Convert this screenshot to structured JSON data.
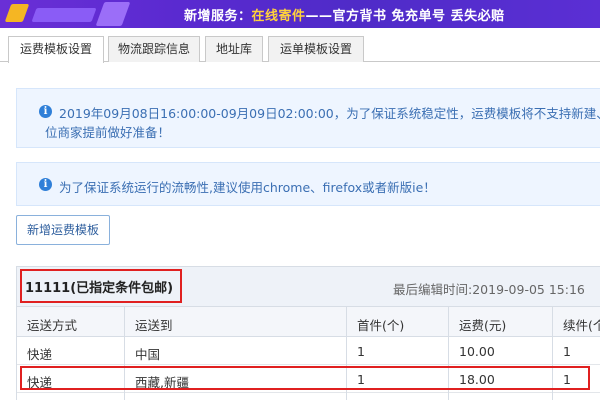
{
  "banner": {
    "prefix": "新增服务：",
    "highlight": "在线寄件",
    "suffix": "——官方背书 免充单号 丢失必赔"
  },
  "tabs": [
    {
      "label": "运费模板设置",
      "active": true
    },
    {
      "label": "物流跟踪信息",
      "active": false
    },
    {
      "label": "地址库",
      "active": false
    },
    {
      "label": "运单模板设置",
      "active": false
    }
  ],
  "notices": {
    "maintenance_line1": "2019年09月08日16:00:00-09月09日02:00:00，为了保证系统稳定性，运费模板将不支持新建、",
    "maintenance_line2": "位商家提前做好准备！",
    "browser": "为了保证系统运行的流畅性,建议使用chrome、firefox或者新版ie！"
  },
  "add_button": "新增运费模板",
  "template": {
    "title": "11111(已指定条件包邮)",
    "last_edit": "最后编辑时间:2019-09-05 15:16",
    "columns": [
      "运送方式",
      "运送到",
      "首件(个)",
      "运费(元)",
      "续件(个"
    ],
    "rows": [
      [
        "快递",
        "中国",
        "1",
        "10.00",
        "1"
      ],
      [
        "快递",
        "西藏,新疆",
        "1",
        "18.00",
        "1"
      ]
    ]
  },
  "colors": {
    "banner_bg": "#5a2ad0",
    "banner_highlight": "#ffd23c",
    "notice_text": "#3b6fb3",
    "highlight_border": "#e02020"
  },
  "icons": {
    "notice": "info-icon"
  }
}
